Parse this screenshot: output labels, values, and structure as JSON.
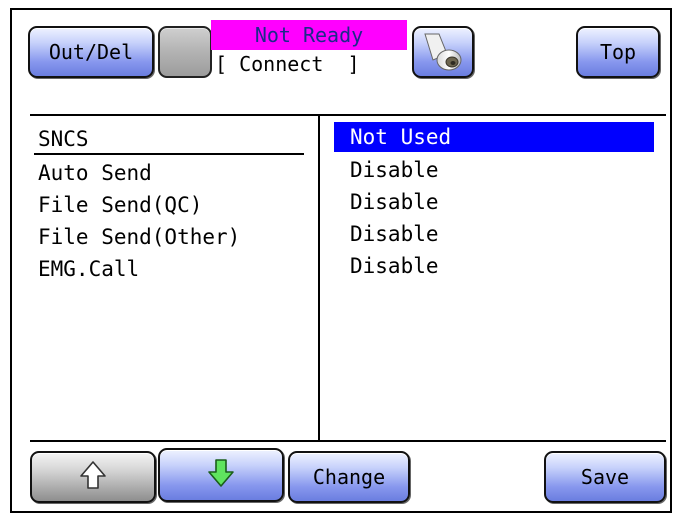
{
  "header": {
    "out_del_label": "Out/Del",
    "top_label": "Top",
    "status": {
      "state": "Not Ready",
      "connection": "[ Connect  ]",
      "state_bg": "#ff00ff"
    },
    "printer_icon": "paper-roll-icon"
  },
  "left_list": {
    "header": "SNCS",
    "items": [
      "Auto Send",
      "File Send(QC)",
      "File Send(Other)",
      "EMG.Call"
    ]
  },
  "right_list": {
    "selected": "Not Used",
    "values": [
      "Disable",
      "Disable",
      "Disable",
      "Disable"
    ],
    "selected_bg": "#0000ff"
  },
  "footer": {
    "up_icon": "arrow-up-icon",
    "down_icon": "arrow-down-icon",
    "change_label": "Change",
    "save_label": "Save"
  }
}
